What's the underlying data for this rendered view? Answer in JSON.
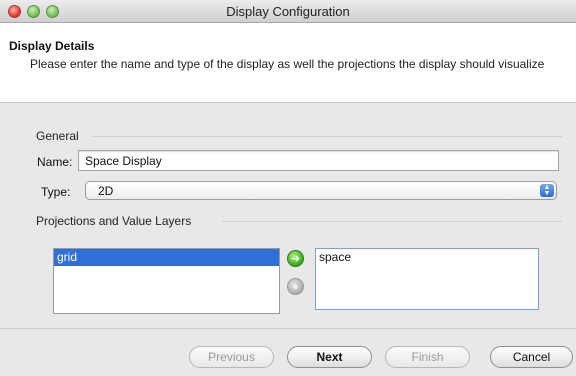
{
  "window": {
    "title": "Display Configuration"
  },
  "header": {
    "title": "Display Details",
    "description": "Please enter the name and type of the display as well the projections the display should visualize"
  },
  "general": {
    "section_label": "General",
    "name_label": "Name:",
    "name_value": "Space Display",
    "type_label": "Type:",
    "type_value": "2D"
  },
  "projections": {
    "section_label": "Projections and Value Layers",
    "available_items": [
      "grid"
    ],
    "selected_items": [
      "space"
    ]
  },
  "footer": {
    "previous_label": "Previous",
    "next_label": "Next",
    "finish_label": "Finish",
    "cancel_label": "Cancel"
  },
  "icons": {
    "close": "close-icon",
    "minimize": "minimize-icon",
    "maximize": "maximize-icon",
    "add": "arrow-right-icon",
    "remove": "remove-icon",
    "select_arrows": "up-down-arrows-icon"
  }
}
